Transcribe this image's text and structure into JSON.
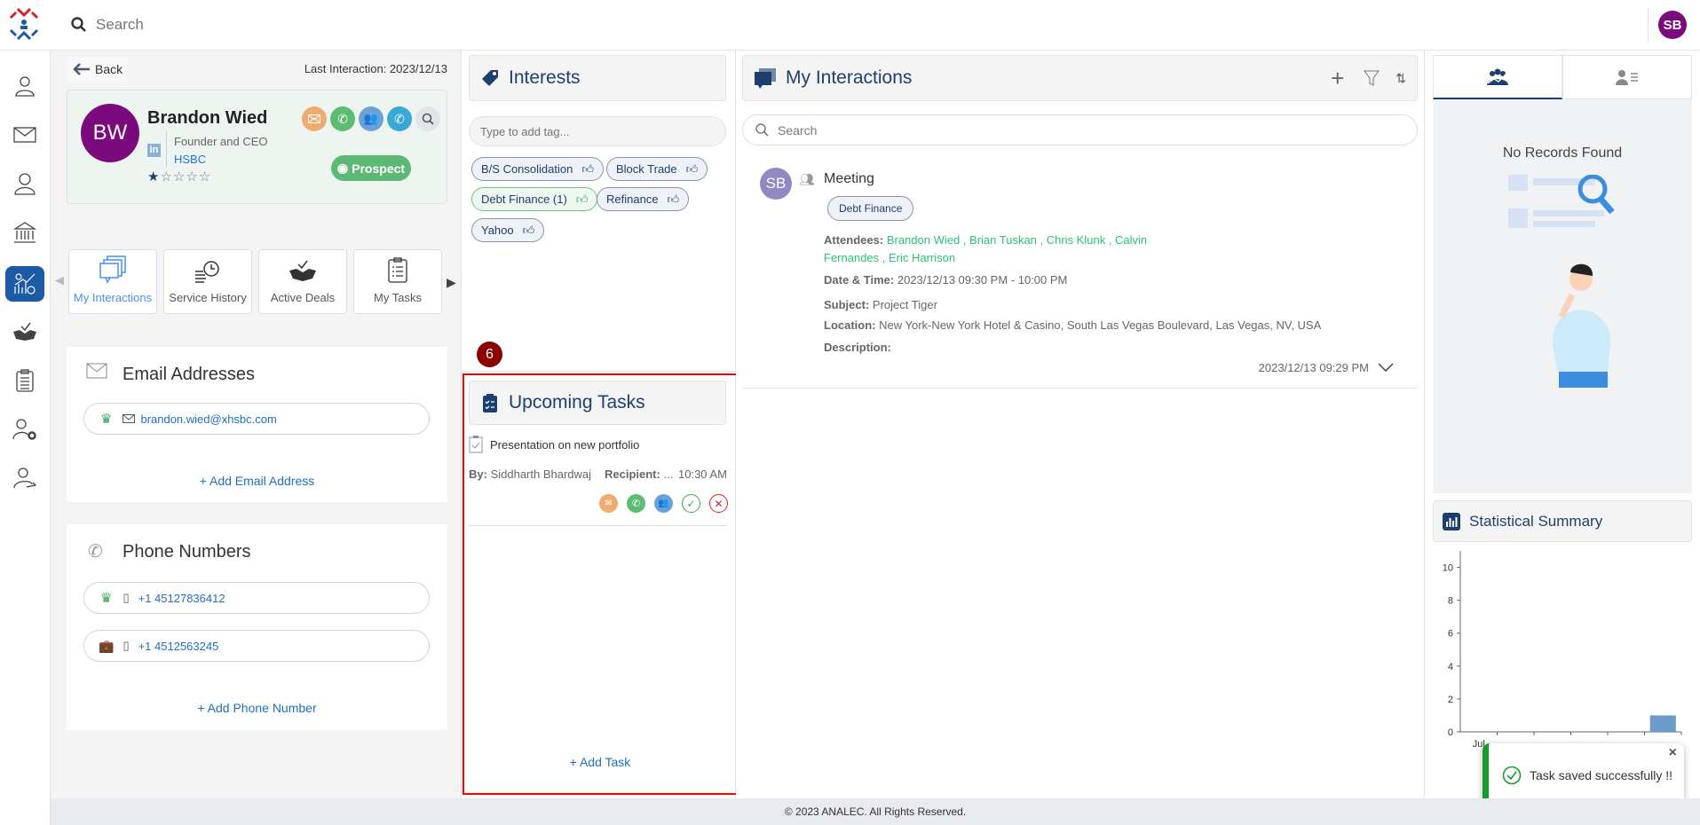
{
  "topbar": {
    "search_placeholder": "Search",
    "user_initials": "SB"
  },
  "sidebar": {
    "items": [
      "contacts-icon",
      "mail-icon",
      "user-icon",
      "bank-icon",
      "analytics-icon",
      "handshake-icon",
      "clipboard-icon",
      "user-settings-icon",
      "user-share-icon"
    ],
    "active": "analytics-icon"
  },
  "profile": {
    "back_label": "Back",
    "last_interaction": "Last Interaction: 2023/12/13",
    "initials": "BW",
    "name": "Brandon Wied",
    "title": "Founder and CEO",
    "company": "HSBC",
    "rating": 1,
    "rating_max": 5,
    "status": "Prospect",
    "avatar_color": "#7b0a7e"
  },
  "tabs": [
    {
      "label": "My Interactions",
      "active": true
    },
    {
      "label": "Service History"
    },
    {
      "label": "Active Deals"
    },
    {
      "label": "My Tasks"
    }
  ],
  "email": {
    "title": "Email Addresses",
    "items": [
      "brandon.wied@xhsbc.com"
    ],
    "add_label": "+ Add Email Address"
  },
  "phone": {
    "title": "Phone Numbers",
    "items": [
      "+1 45127836412",
      "+1 4512563245"
    ],
    "add_label": "+ Add Phone Number"
  },
  "interests": {
    "title": "Interests",
    "placeholder": "Type to add tag...",
    "tags": [
      "B/S Consolidation",
      "Block Trade",
      "Debt Finance (1)",
      "Refinance",
      "Yahoo"
    ]
  },
  "tasks": {
    "badge": "6",
    "title": "Upcoming Tasks",
    "items": [
      {
        "title": "Presentation on new portfolio",
        "by_label": "By:",
        "by": "Siddharth Bhardwaj",
        "recipient_label": "Recipient:",
        "recipient": "...",
        "time": "10:30 AM"
      }
    ],
    "add_label": "+ Add Task"
  },
  "interactions": {
    "title": "My Interactions",
    "search_placeholder": "Search",
    "items": [
      {
        "initials": "SB",
        "type": "Meeting",
        "tag": "Debt Finance",
        "attendees_label": "Attendees:",
        "attendees": "Brandon Wied , Brian Tuskan , Chris Klunk , Calvin Fernandes , Eric Harrison",
        "datetime_label": "Date & Time:",
        "datetime": "2023/12/13 09:30 PM - 10:00 PM",
        "subject_label": "Subject:",
        "subject": "Project Tiger",
        "location_label": "Location:",
        "location": "New York-New York Hotel & Casino, South Las Vegas Boulevard, Las Vegas, NV, USA",
        "description_label": "Description:",
        "timestamp": "2023/12/13 09:29 PM"
      }
    ]
  },
  "right": {
    "no_records": "No Records Found",
    "stat_title": "Statistical Summary"
  },
  "chart_data": {
    "type": "bar",
    "categories": [
      "Jul",
      "",
      "",
      "",
      "",
      ""
    ],
    "values": [
      0,
      0,
      0,
      0,
      0,
      1
    ],
    "ylim": [
      0,
      11
    ],
    "yticks": [
      0,
      2,
      4,
      6,
      8,
      10
    ],
    "color": "#6b9bcc",
    "grid": false
  },
  "toast": {
    "message": "Task saved successfully !!"
  },
  "footer": {
    "text": "© 2023 ANALEC. All Rights Reserved."
  }
}
